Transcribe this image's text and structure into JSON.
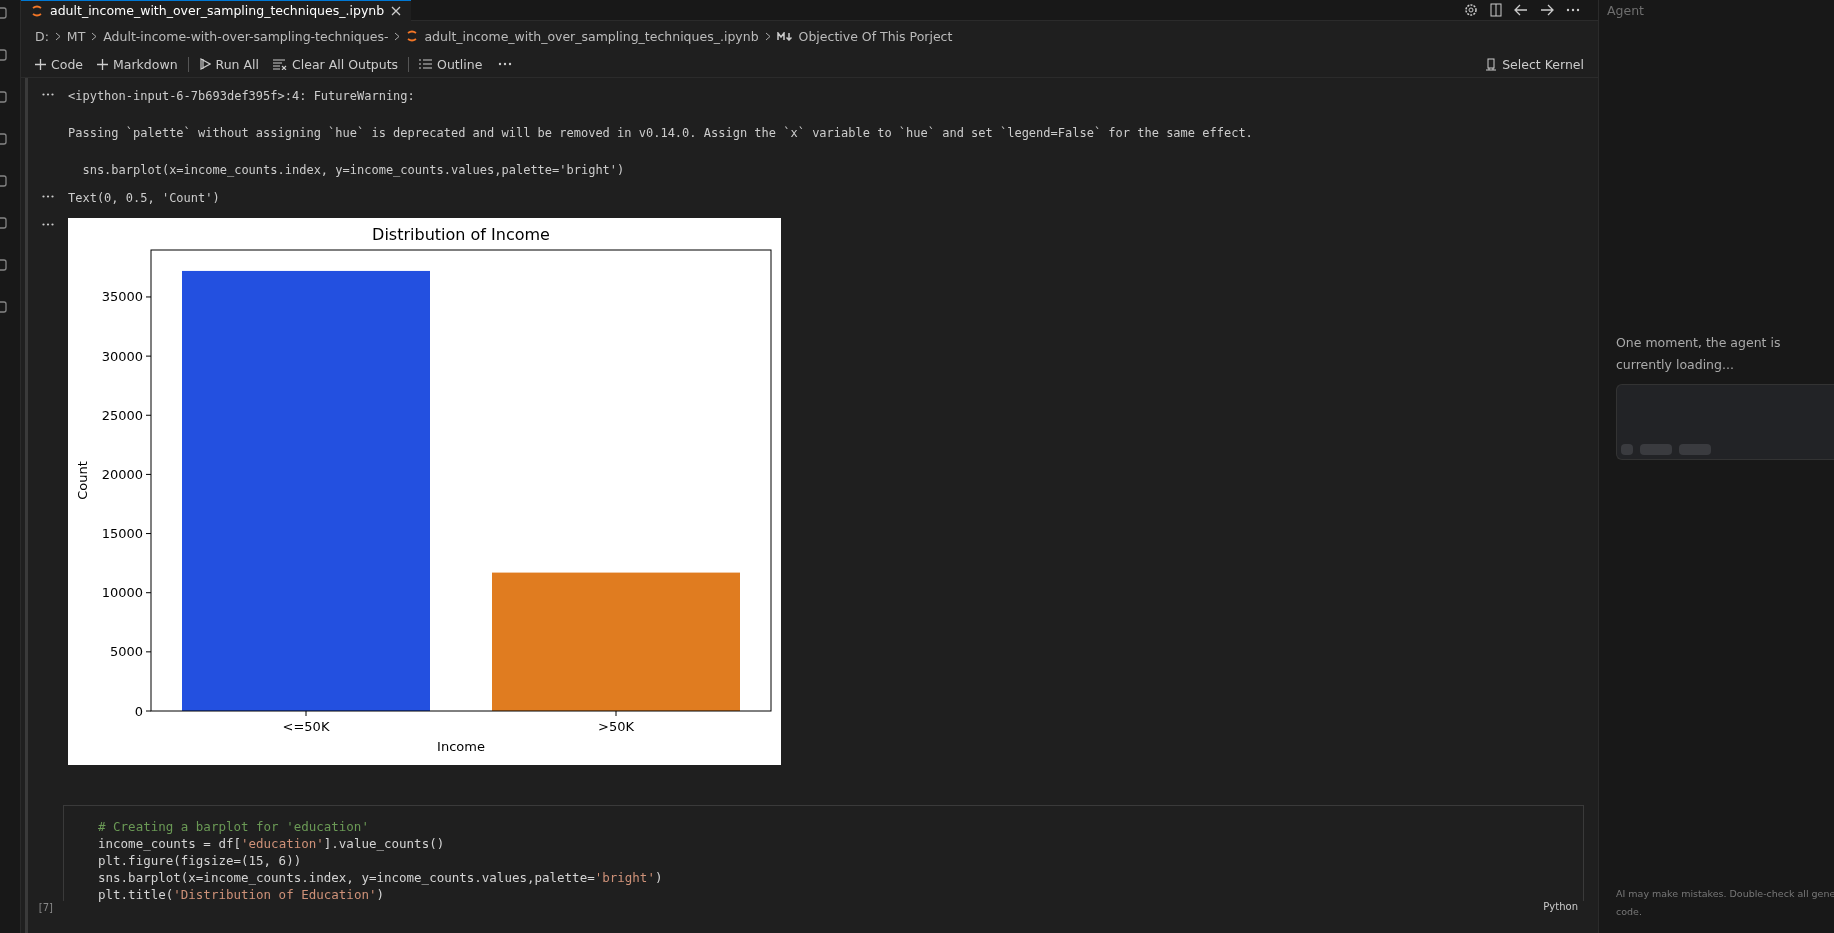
{
  "editor_tab": {
    "title": "adult_income_with_over_sampling_techniques_.ipynb",
    "selected": true
  },
  "breadcrumb": [
    "D:",
    "MT",
    "Adult-income-with-over-sampling-techniques-",
    "adult_income_with_over_sampling_techniques_.ipynb",
    "Objective Of This Porject"
  ],
  "toolbar": [
    "Code",
    "Markdown",
    "Run All",
    "Clear All Outputs",
    "Outline"
  ],
  "kernel_button": "Select Kernel",
  "outputs": [
    {
      "kind": "text",
      "lines": [
        "<ipython-input-6-7b693def395f>:4: FutureWarning:",
        "Passing `palette` without assigning `hue` is deprecated and will be removed in v0.14.0. Assign the `x` variable to `hue` and set `legend=False` for the same effect.",
        "  sns.barplot(x=income_counts.index, y=income_counts.values,palette='bright')"
      ]
    },
    {
      "kind": "text",
      "lines": [
        "Text(0, 0.5, 'Count')"
      ]
    },
    {
      "kind": "chart",
      "chart_data": {
        "type": "bar",
        "title": "Distribution of Income",
        "xlabel": "Income",
        "ylabel": "Count",
        "categories": [
          "<=50K",
          ">50K"
        ],
        "series": [
          {
            "color": "#2350e0",
            "values": [
              37200,
              null
            ]
          },
          {
            "color": "#e07c20",
            "values": [
              null,
              11700
            ]
          }
        ],
        "ylim": [
          0,
          38970
        ],
        "yticks": [
          0,
          5000,
          10000,
          15000,
          20000,
          25000,
          30000,
          35000
        ]
      }
    }
  ],
  "code_cell": {
    "execution_count": "[7]",
    "language": "Python",
    "lines": [
      [
        {
          "kind": "comment",
          "text": "# Creating a barplot for 'education'"
        }
      ],
      [
        {
          "kind": "plain",
          "text": "income_counts = df["
        },
        {
          "kind": "string",
          "text": "'education'"
        },
        {
          "kind": "plain",
          "text": "].value_counts()"
        }
      ],
      [
        {
          "kind": "plain",
          "text": "plt.figure(figsize=(15, 6))"
        }
      ],
      [
        {
          "kind": "plain",
          "text": "sns.barplot(x=income_counts.index, y=income_counts.values,palette="
        },
        {
          "kind": "string",
          "text": "'bright'"
        },
        {
          "kind": "plain",
          "text": ")"
        }
      ],
      [
        {
          "kind": "plain",
          "text": "plt.title("
        },
        {
          "kind": "string",
          "text": "'Distribution of Education'"
        },
        {
          "kind": "plain",
          "text": ")"
        }
      ]
    ]
  },
  "agent": {
    "title": "Agent",
    "message": "One moment, the agent is currently loading...",
    "disclaimer": [
      "AI may make mistakes. Double-check all gene",
      "code."
    ]
  }
}
